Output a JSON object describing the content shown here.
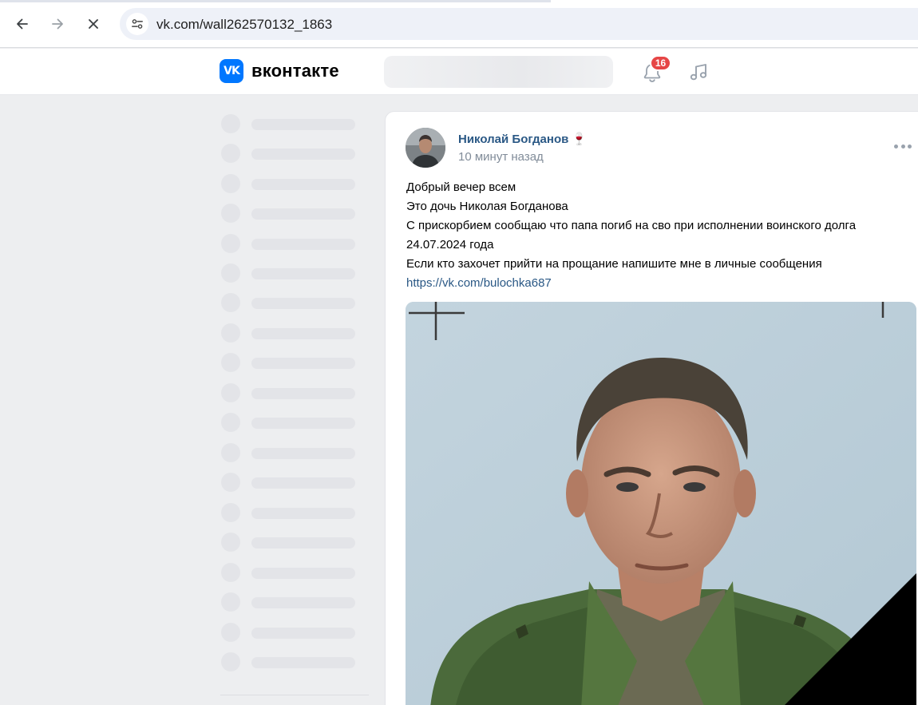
{
  "browser": {
    "url": "vk.com/wall262570132_1863",
    "icons": [
      "back-arrow-icon",
      "forward-arrow-icon",
      "close-icon",
      "site-info-icon"
    ]
  },
  "header": {
    "logo_mark": "VK",
    "logo_text": "вконтакте",
    "notifications_count": "16",
    "accent_color": "#0077ff",
    "badge_color": "#e64646",
    "icons": [
      "bell-icon",
      "music-icon"
    ]
  },
  "post": {
    "author": "Николай Богданов",
    "author_emoji": "🍷",
    "time": "10 минут назад",
    "text_lines": [
      "Добрый вечер всем",
      "Это дочь Николая Богданова",
      "С прискорбием сообщаю что папа погиб на сво при исполнении воинского долга",
      "24.07.2024 года",
      "Если кто захочет прийти на прощание напишите мне в личные сообщения"
    ],
    "link": "https://vk.com/bulochka687",
    "link_color": "#2a5885",
    "icons": [
      "more-icon"
    ]
  }
}
